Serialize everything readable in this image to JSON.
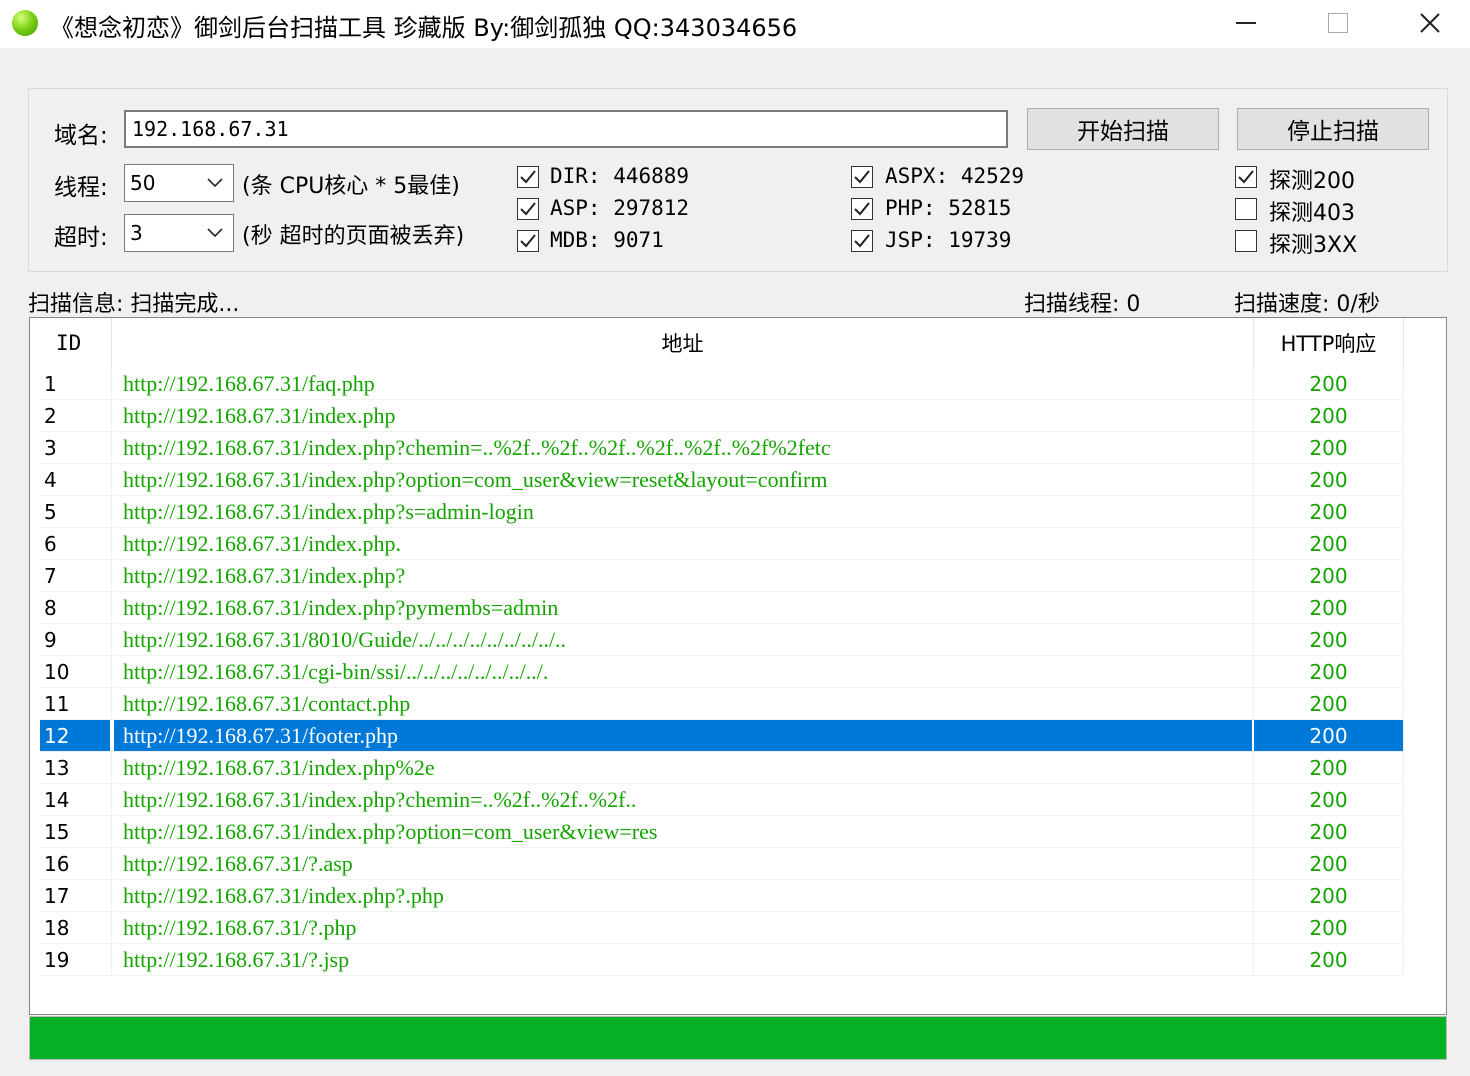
{
  "window": {
    "title": "《想念初恋》御剑后台扫描工具 珍藏版 By:御剑孤独 QQ:343034656"
  },
  "form": {
    "domain_label": "域名:",
    "domain_value": "192.168.67.31",
    "start_button": "开始扫描",
    "stop_button": "停止扫描",
    "threads_label": "线程:",
    "threads_value": "50",
    "threads_hint": "(条 CPU核心 * 5最佳)",
    "timeout_label": "超时:",
    "timeout_value": "3",
    "timeout_hint": "(秒 超时的页面被丢弃)"
  },
  "dictionaries": [
    {
      "label": "DIR: 446889",
      "checked": true
    },
    {
      "label": "ASP: 297812",
      "checked": true
    },
    {
      "label": "MDB: 9071",
      "checked": true
    },
    {
      "label": "ASPX: 42529",
      "checked": true
    },
    {
      "label": "PHP: 52815",
      "checked": true
    },
    {
      "label": "JSP: 19739",
      "checked": true
    }
  ],
  "detect": [
    {
      "label": "探测200",
      "checked": true
    },
    {
      "label": "探测403",
      "checked": false
    },
    {
      "label": "探测3XX",
      "checked": false
    }
  ],
  "status": {
    "info": "扫描信息: 扫描完成...",
    "threads": "扫描线程: 0",
    "speed": "扫描速度: 0/秒"
  },
  "table": {
    "headers": {
      "id": "ID",
      "address": "地址",
      "code": "HTTP响应"
    },
    "selected_index": 11,
    "rows": [
      {
        "id": "1",
        "url": "http://192.168.67.31/faq.php",
        "code": "200"
      },
      {
        "id": "2",
        "url": "http://192.168.67.31/index.php",
        "code": "200"
      },
      {
        "id": "3",
        "url": "http://192.168.67.31/index.php?chemin=..%2f..%2f..%2f..%2f..%2f..%2f%2fetc",
        "code": "200"
      },
      {
        "id": "4",
        "url": "http://192.168.67.31/index.php?option=com_user&view=reset&layout=confirm",
        "code": "200"
      },
      {
        "id": "5",
        "url": "http://192.168.67.31/index.php?s=admin-login",
        "code": "200"
      },
      {
        "id": "6",
        "url": "http://192.168.67.31/index.php.",
        "code": "200"
      },
      {
        "id": "7",
        "url": "http://192.168.67.31/index.php?",
        "code": "200"
      },
      {
        "id": "8",
        "url": "http://192.168.67.31/index.php?pymembs=admin",
        "code": "200"
      },
      {
        "id": "9",
        "url": "http://192.168.67.31/8010/Guide/../../../../../../../../..",
        "code": "200"
      },
      {
        "id": "10",
        "url": "http://192.168.67.31/cgi-bin/ssi/../../../../../../../../.",
        "code": "200"
      },
      {
        "id": "11",
        "url": "http://192.168.67.31/contact.php",
        "code": "200"
      },
      {
        "id": "12",
        "url": "http://192.168.67.31/footer.php",
        "code": "200"
      },
      {
        "id": "13",
        "url": "http://192.168.67.31/index.php%2e",
        "code": "200"
      },
      {
        "id": "14",
        "url": "http://192.168.67.31/index.php?chemin=..%2f..%2f..%2f..",
        "code": "200"
      },
      {
        "id": "15",
        "url": "http://192.168.67.31/index.php?option=com_user&view=res",
        "code": "200"
      },
      {
        "id": "16",
        "url": "http://192.168.67.31/?.asp",
        "code": "200"
      },
      {
        "id": "17",
        "url": "http://192.168.67.31/index.php?.php",
        "code": "200"
      },
      {
        "id": "18",
        "url": "http://192.168.67.31/?.php",
        "code": "200"
      },
      {
        "id": "19",
        "url": "http://192.168.67.31/?.jsp",
        "code": "200"
      }
    ]
  },
  "progress": {
    "fraction": 1.0
  },
  "colors": {
    "url_green": "#13a400",
    "selection_blue": "#0078d7",
    "progress_green": "#06b025"
  },
  "icons": {
    "app": "green-orb-icon",
    "minimize": "minimize-icon",
    "maximize": "maximize-icon",
    "close": "close-icon"
  }
}
